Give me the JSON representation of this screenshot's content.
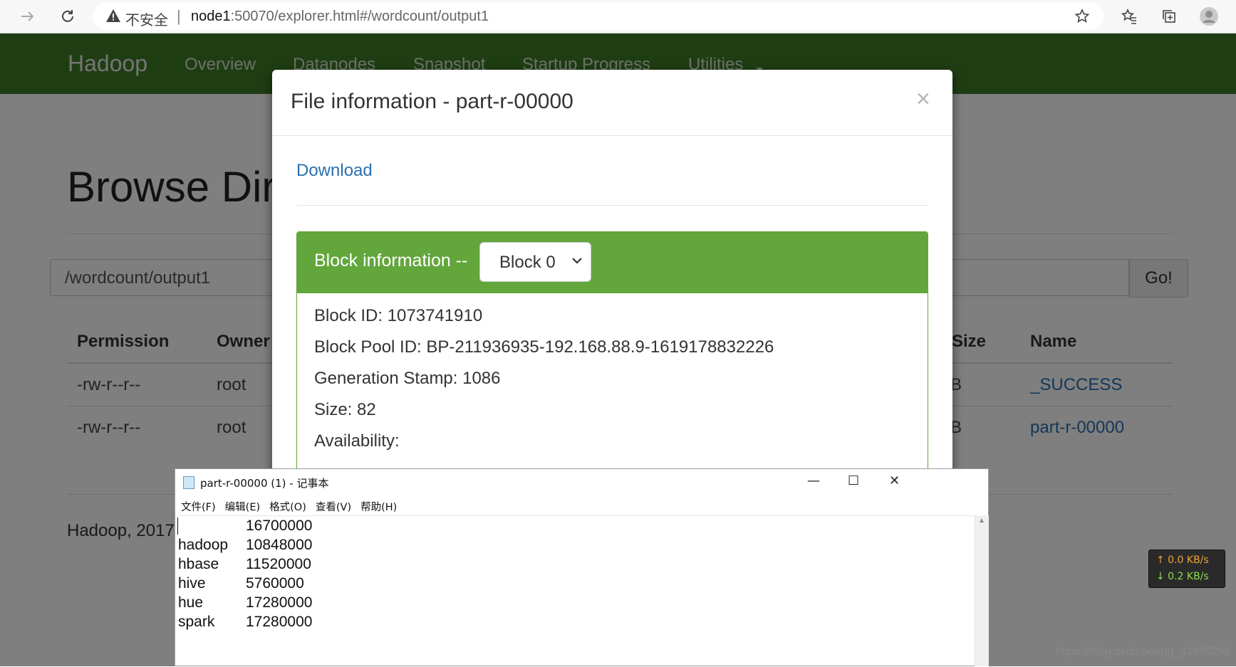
{
  "browser": {
    "insecure_label": "不安全",
    "url_host": "node1",
    "url_rest": ":50070/explorer.html#/wordcount/output1"
  },
  "navbar": {
    "brand": "Hadoop",
    "items": [
      "Overview",
      "Datanodes",
      "Snapshot",
      "Startup Progress",
      "Utilities"
    ]
  },
  "page": {
    "title": "Browse Directory",
    "path_value": "/wordcount/output1",
    "go_label": "Go!",
    "footer": "Hadoop, 2017."
  },
  "table": {
    "headers": {
      "permission": "Permission",
      "owner": "Owner",
      "size": "Size",
      "name": "Name"
    },
    "rows": [
      {
        "permission": "-rw-r--r--",
        "owner": "root",
        "size_tail": "B",
        "name": "_SUCCESS"
      },
      {
        "permission": "-rw-r--r--",
        "owner": "root",
        "size_tail": "B",
        "name": "part-r-00000"
      }
    ]
  },
  "modal": {
    "title": "File information - part-r-00000",
    "close": "×",
    "download": "Download",
    "block_title": "Block information --",
    "block_selected": "Block 0",
    "lines": [
      "Block ID: 1073741910",
      "Block Pool ID: BP-211936935-192.168.88.9-1619178832226",
      "Generation Stamp: 1086",
      "Size: 82",
      "Availability:"
    ]
  },
  "notepad": {
    "title": "part-r-00000 (1) - 记事本",
    "controls": {
      "minimize": "—",
      "maximize": "☐",
      "close": "✕"
    },
    "menu": [
      "文件(F)",
      "编辑(E)",
      "格式(O)",
      "查看(V)",
      "帮助(H)"
    ],
    "lines": [
      {
        "key": "",
        "value": "16700000"
      },
      {
        "key": "hadoop",
        "value": "10848000"
      },
      {
        "key": "hbase",
        "value": "11520000"
      },
      {
        "key": "hive",
        "value": "5760000"
      },
      {
        "key": "hue",
        "value": "17280000"
      },
      {
        "key": "spark",
        "value": "17280000"
      }
    ]
  },
  "net_speed": {
    "up": "↑ 0.0 KB/s",
    "down": "↓ 0.2 KB/s"
  },
  "watermark": "https://blog.csdn.net/qq_41990268",
  "colors": {
    "navbar": "#3e7b27",
    "panel_green": "#62a63c",
    "link": "#2a6fb0"
  }
}
